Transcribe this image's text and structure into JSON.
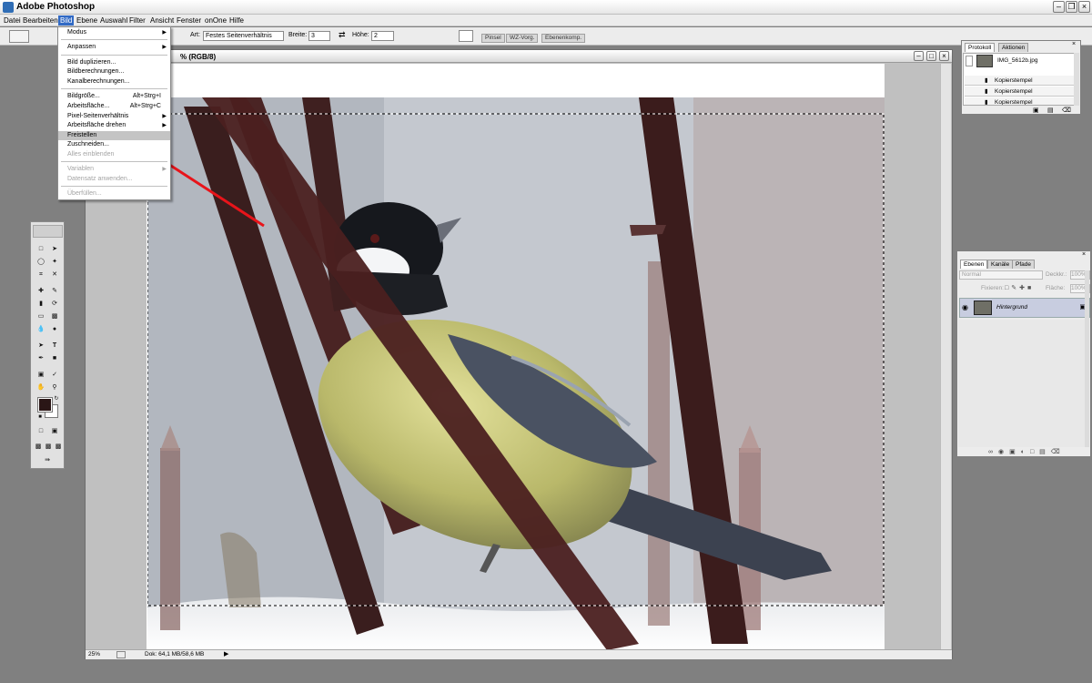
{
  "window": {
    "title": "Adobe Photoshop"
  },
  "menubar": {
    "items": [
      "Datei",
      "Bearbeiten",
      "Bild",
      "Ebene",
      "Auswahl",
      "Filter",
      "Ansicht",
      "Fenster",
      "onOne",
      "Hilfe"
    ]
  },
  "options": {
    "art_label": "Art:",
    "art_value": "Festes Seitenverhältnis",
    "breite_label": "Breite:",
    "breite_value": "3",
    "hoehe_label": "Höhe:",
    "hoehe_value": "2",
    "well_tabs": [
      "Pinsel",
      "WZ-Vorg.",
      "Ebenenkomp."
    ]
  },
  "bild_menu": {
    "modus": "Modus",
    "anpassen": "Anpassen",
    "bild_duplizieren": "Bild duplizieren...",
    "bildberechnungen": "Bildberechnungen...",
    "kanalberechnungen": "Kanalberechnungen...",
    "bildgroesse": "Bildgröße...",
    "bildgroesse_sc": "Alt+Strg+I",
    "arbeitsflaeche": "Arbeitsfläche...",
    "arbeitsflaeche_sc": "Alt+Strg+C",
    "pixel_seitenverhaeltnis": "Pixel-Seitenverhältnis",
    "arbeitsflaeche_drehen": "Arbeitsfläche drehen",
    "freistellen": "Freistellen",
    "zuschneiden": "Zuschneiden...",
    "alles_einblenden": "Alles einblenden",
    "variablen": "Variablen",
    "datensatz": "Datensatz anwenden...",
    "ueberfuellen": "Überfüllen..."
  },
  "document": {
    "title": "% (RGB/8)",
    "zoom": "25%",
    "status": "Dok: 64,1 MB/58,6 MB"
  },
  "history_panel": {
    "tabs": [
      "Protokoll",
      "Aktionen"
    ],
    "snapshot": "IMG_5612b.jpg",
    "steps": [
      "Kopierstempel",
      "Kopierstempel",
      "Kopierstempel"
    ]
  },
  "layers_panel": {
    "tabs": [
      "Ebenen",
      "Kanäle",
      "Pfade"
    ],
    "blend_mode": "Normal",
    "deckkraft_label": "Deckkr.:",
    "deckkraft_value": "100%",
    "fixieren_label": "Fixieren:",
    "flaeche_label": "Fläche:",
    "flaeche_value": "100%",
    "layer_name": "Hintergrund"
  },
  "colors": {
    "foreground": "#2a1616",
    "background": "#ffffff",
    "arrow": "#e8141a",
    "menu_highlight": "#316ac5"
  }
}
